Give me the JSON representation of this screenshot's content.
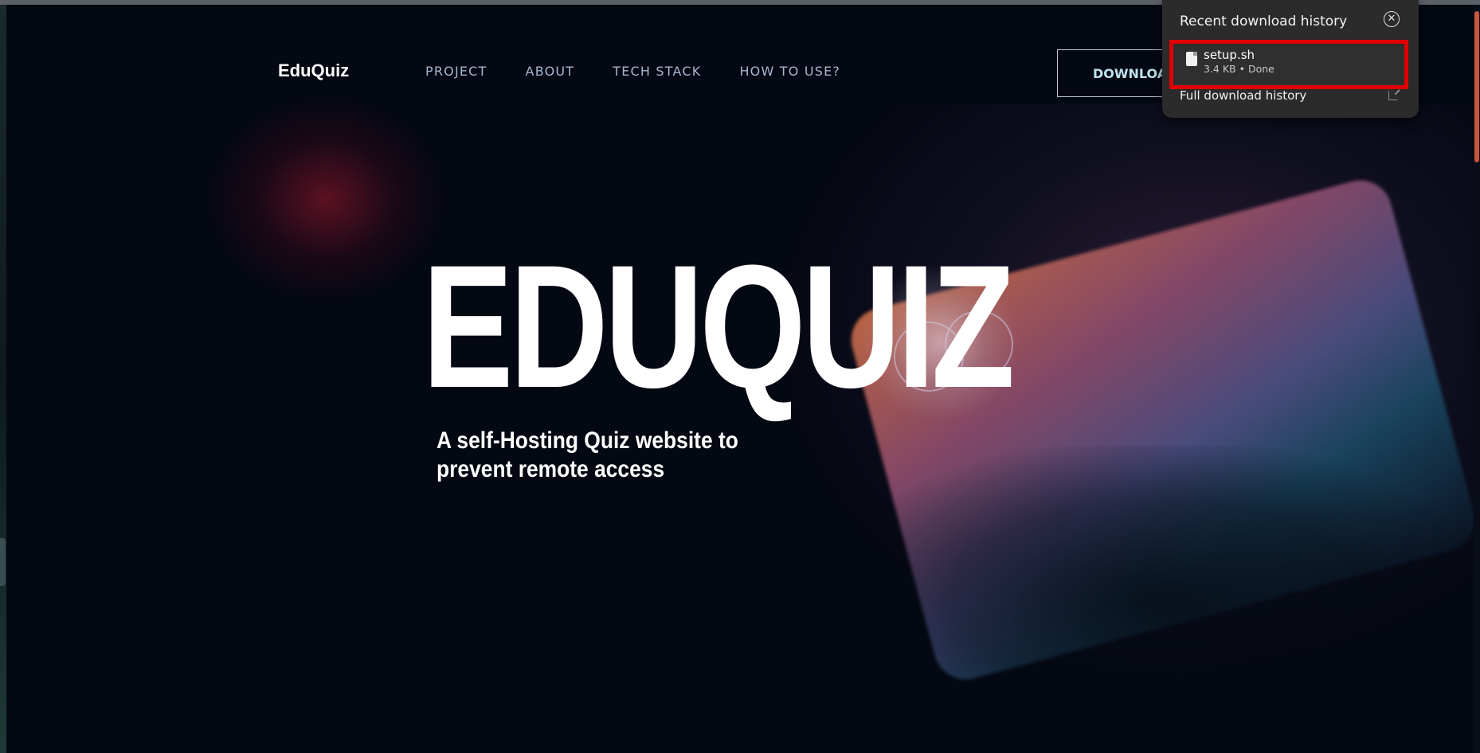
{
  "site": {
    "logo": "EduQuiz",
    "nav": [
      "PROJECT",
      "ABOUT",
      "TECH STACK",
      "HOW TO USE?"
    ],
    "download_button": "DOWNLOAD"
  },
  "hero": {
    "title": "EDUQUIZ",
    "subtitle": "A self-Hosting Quiz website to prevent remote access"
  },
  "download_panel": {
    "title": "Recent download history",
    "close_icon": "close-circle-icon",
    "item": {
      "file_icon": "file-icon",
      "filename": "setup.sh",
      "meta": "3.4 KB • Done"
    },
    "full_history": "Full download history",
    "full_history_icon": "external-link-icon"
  },
  "colors": {
    "background": "#040812",
    "nav_text": "#a7b7cf",
    "highlight_border": "#e00000",
    "popup_bg": "#2b2b2b"
  }
}
